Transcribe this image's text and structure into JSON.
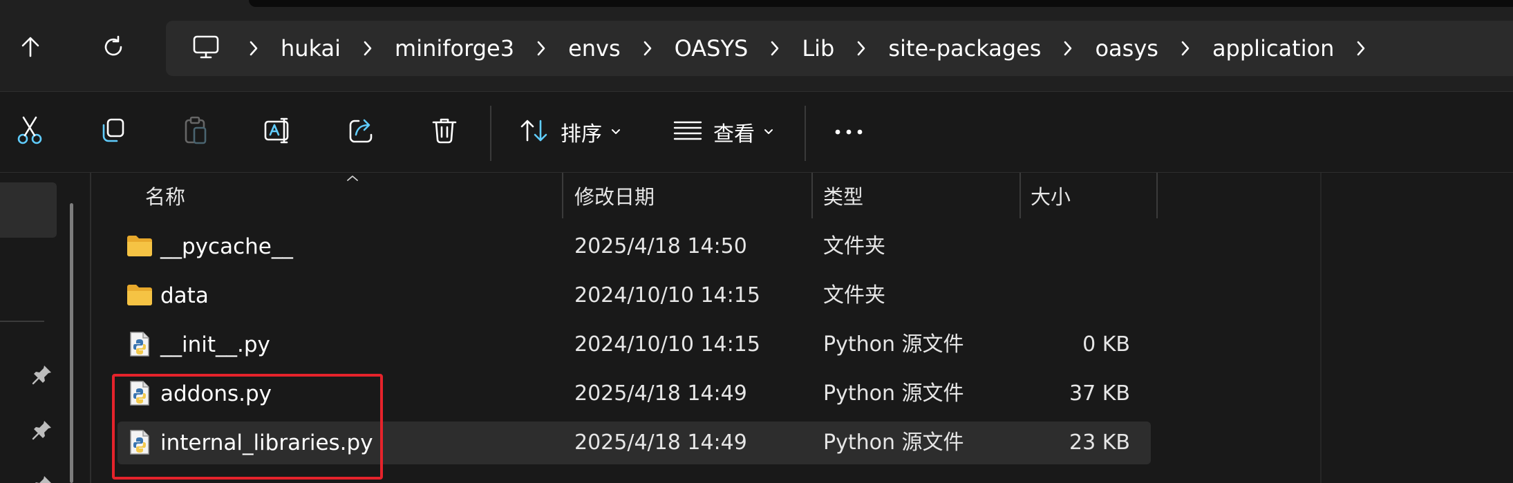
{
  "nav": {
    "up_icon": "arrow-up-icon",
    "refresh_icon": "refresh-icon"
  },
  "breadcrumb": {
    "root_icon": "computer-icon",
    "items": [
      {
        "label": "hukai"
      },
      {
        "label": "miniforge3"
      },
      {
        "label": "envs"
      },
      {
        "label": "OASYS"
      },
      {
        "label": "Lib"
      },
      {
        "label": "site-packages"
      },
      {
        "label": "oasys"
      },
      {
        "label": "application"
      }
    ],
    "trailing_icon": "chevron-right-icon"
  },
  "commands": {
    "cut_icon": "scissors-icon",
    "copy_icon": "copy-icon",
    "paste_icon": "clipboard-icon",
    "rename_icon": "rename-icon",
    "share_icon": "share-icon",
    "delete_icon": "trash-icon",
    "sort_label": "排序",
    "view_label": "查看",
    "more_icon": "more-icon"
  },
  "columns": {
    "name": "名称",
    "modified": "修改日期",
    "type": "类型",
    "size": "大小"
  },
  "files": [
    {
      "name": "__pycache__",
      "modified": "2025/4/18 14:50",
      "type": "文件夹",
      "size": "",
      "icon": "folder-icon"
    },
    {
      "name": "data",
      "modified": "2024/10/10 14:15",
      "type": "文件夹",
      "size": "",
      "icon": "folder-icon"
    },
    {
      "name": "__init__.py",
      "modified": "2024/10/10 14:15",
      "type": "Python 源文件",
      "size": "0 KB",
      "icon": "python-file-icon"
    },
    {
      "name": "addons.py",
      "modified": "2025/4/18 14:49",
      "type": "Python 源文件",
      "size": "37 KB",
      "icon": "python-file-icon"
    },
    {
      "name": "internal_libraries.py",
      "modified": "2025/4/18 14:49",
      "type": "Python 源文件",
      "size": "23 KB",
      "icon": "python-file-icon"
    }
  ],
  "colors": {
    "background": "#191919",
    "address_bar": "#2b2b2b",
    "accent": "#60cdff",
    "folder": "#f5c344",
    "annotation": "#e5232b"
  }
}
